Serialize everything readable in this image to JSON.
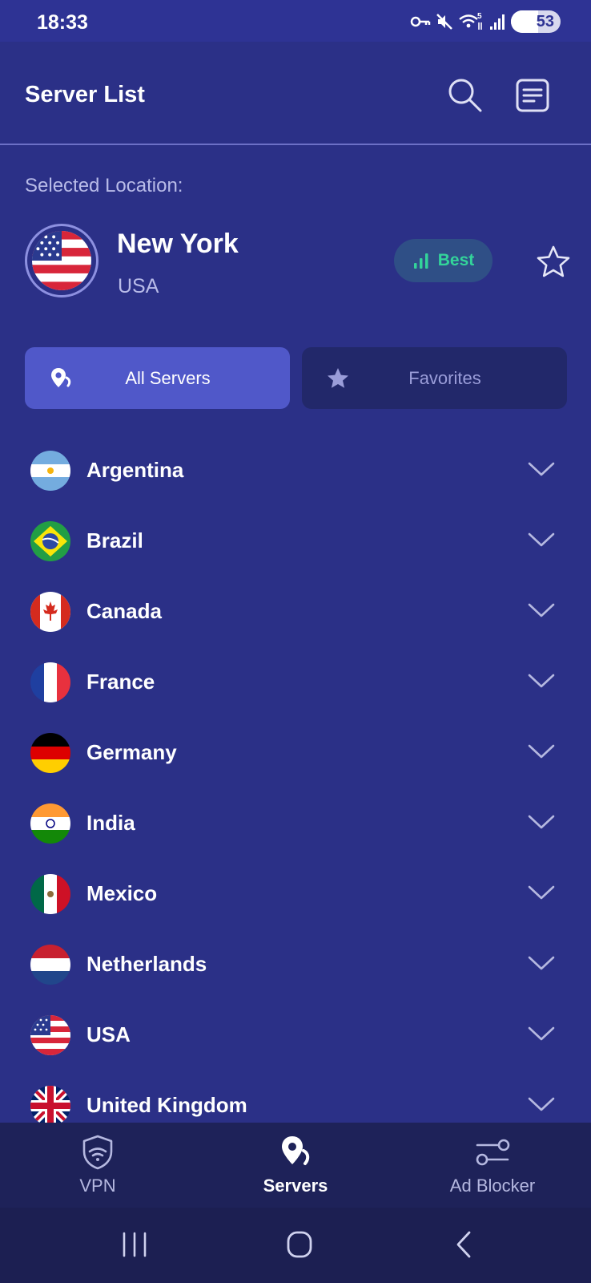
{
  "status_bar": {
    "time": "18:33",
    "battery": "53",
    "icons": [
      "vpn-key-icon",
      "mute-icon",
      "wifi-icon",
      "signal-icon",
      "battery-icon"
    ]
  },
  "app_bar": {
    "title": "Server List",
    "icons": [
      "search-icon",
      "list-icon"
    ]
  },
  "selected": {
    "label": "Selected Location:",
    "city": "New York",
    "country": "USA",
    "badge": "Best",
    "flag": "us"
  },
  "tabs": {
    "all": "All Servers",
    "favorites": "Favorites",
    "active": "all"
  },
  "countries": [
    {
      "name": "Argentina",
      "flag": "ar"
    },
    {
      "name": "Brazil",
      "flag": "br"
    },
    {
      "name": "Canada",
      "flag": "ca"
    },
    {
      "name": "France",
      "flag": "fr"
    },
    {
      "name": "Germany",
      "flag": "de"
    },
    {
      "name": "India",
      "flag": "in"
    },
    {
      "name": "Mexico",
      "flag": "mx"
    },
    {
      "name": "Netherlands",
      "flag": "nl"
    },
    {
      "name": "USA",
      "flag": "us"
    },
    {
      "name": "United Kingdom",
      "flag": "gb"
    }
  ],
  "bottom_nav": {
    "vpn": "VPN",
    "servers": "Servers",
    "ad_blocker": "Ad Blocker",
    "active": "servers"
  },
  "colors": {
    "background": "#2b3087",
    "active_tab": "#5058c9",
    "inactive_tab": "#22286a",
    "best_badge_text": "#33d49a",
    "nav_background": "#1e2259"
  }
}
